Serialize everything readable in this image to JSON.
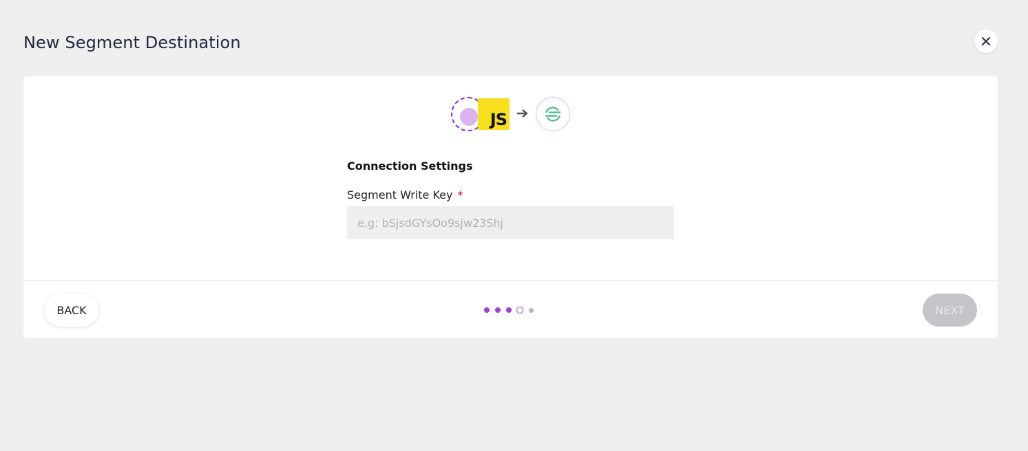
{
  "page": {
    "title": "New Segment Destination"
  },
  "close_button": {
    "icon": "close-icon"
  },
  "flow": {
    "source_icon": "javascript-source-icon",
    "source_logo_text": "JS",
    "arrow_icon": "arrow-right-icon",
    "destination_icon": "segment-logo-icon",
    "colors": {
      "accent": "#a43fd6",
      "js_yellow": "#f7df1e",
      "segment_green": "#52bd94"
    }
  },
  "form": {
    "section_title": "Connection Settings",
    "write_key": {
      "label": "Segment Write Key",
      "required_mark": "*",
      "value": "",
      "placeholder": "e.g: bSjsdGYsOo9sjw23Shj"
    }
  },
  "footer": {
    "back_label": "BACK",
    "next_label": "NEXT",
    "next_enabled": false,
    "stepper": {
      "total_steps": 5,
      "current_step": 4,
      "steps": [
        "done",
        "done",
        "done",
        "current",
        "future"
      ]
    }
  }
}
